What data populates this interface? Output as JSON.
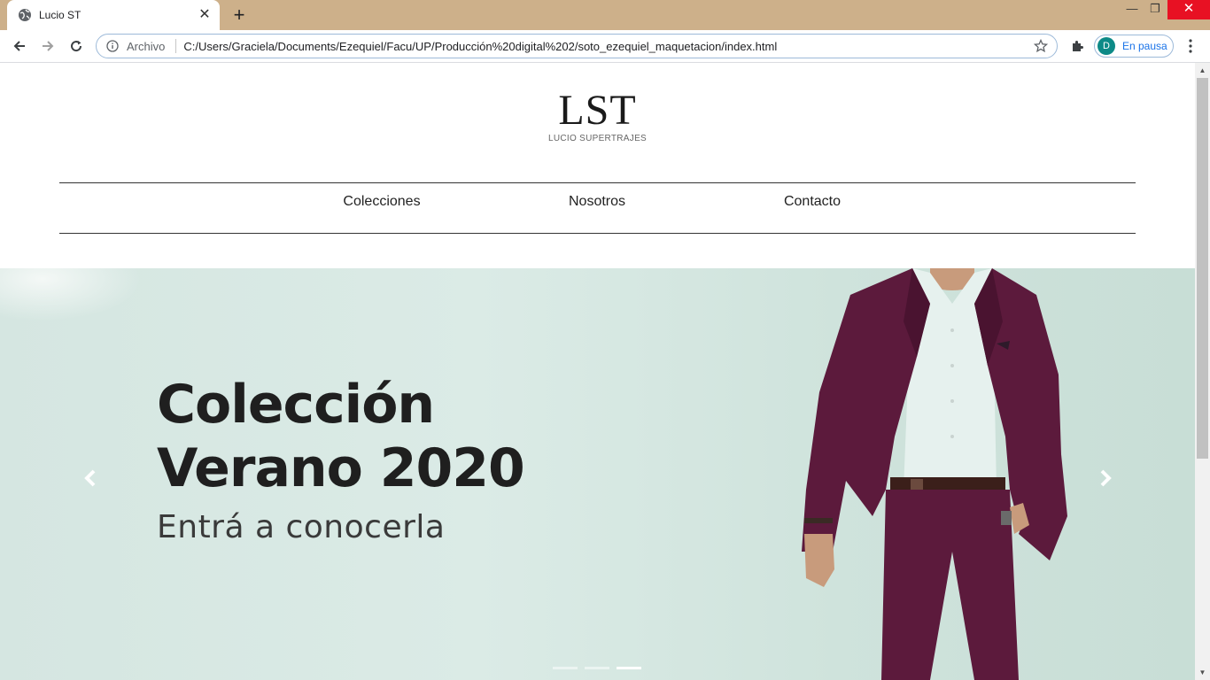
{
  "browser": {
    "tab_title": "Lucio ST",
    "new_tab_glyph": "+",
    "origin_label": "Archivo",
    "url": "C:/Users/Graciela/Documents/Ezequiel/Facu/UP/Producción%20digital%202/soto_ezequiel_maquetacion/index.html",
    "profile_initial": "D",
    "profile_label": "En pausa",
    "colors": {
      "tabbar": "#cdb08a",
      "close": "#e81123",
      "avatar": "#0d8a87",
      "profile_text": "#1a73e8"
    },
    "icons": [
      "globe-icon",
      "close-icon",
      "back-icon",
      "forward-icon",
      "reload-icon",
      "info-icon",
      "star-icon",
      "extensions-icon",
      "menu-icon",
      "minimize-icon",
      "restore-icon"
    ]
  },
  "site": {
    "logo_main": "LST",
    "logo_sub": "LUCIO SUPERTRAJES",
    "nav": [
      "Colecciones",
      "Nosotros",
      "Contacto"
    ],
    "hero": {
      "title_line1": "Colección",
      "title_line2": "Verano 2020",
      "subtitle": "Entrá a conocerla",
      "slide_count": 3,
      "active_slide": 3,
      "suit_color": "#5c1a3c",
      "background_color": "#d5e6e1"
    }
  }
}
